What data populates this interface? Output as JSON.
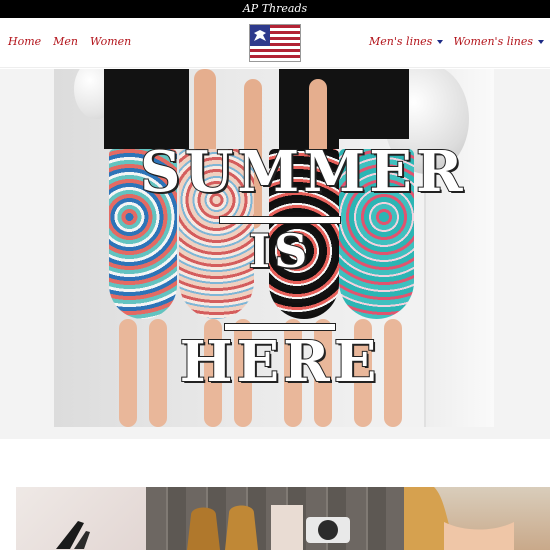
{
  "topbar": {
    "title": "AP Threads"
  },
  "nav": {
    "left": [
      {
        "label": "Home"
      },
      {
        "label": "Men"
      },
      {
        "label": "Women"
      }
    ],
    "right": [
      {
        "label": "Men's lines"
      },
      {
        "label": "Women's lines"
      }
    ],
    "logo_icon": "american-flag-eagle-logo"
  },
  "hero": {
    "line1": "SUMMER",
    "line2": "IS",
    "line3": "HERE"
  },
  "colors": {
    "nav_text": "#b3151c",
    "caret": "#1d2b86",
    "topbar_bg": "#000000"
  }
}
